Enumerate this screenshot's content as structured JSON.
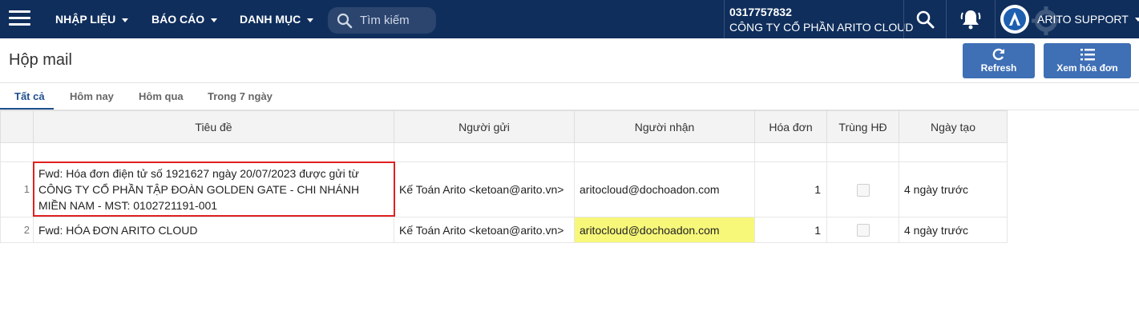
{
  "nav": {
    "items": [
      {
        "label": "NHẬP LIỆU"
      },
      {
        "label": "BÁO CÁO"
      },
      {
        "label": "DANH MỤC"
      }
    ],
    "search_placeholder": "Tìm kiếm",
    "company_tax_id": "0317757832",
    "company_name": "CÔNG TY CỔ PHẦN ARITO CLOUD",
    "user_name": "ARITO SUPPORT"
  },
  "page": {
    "title": "Hộp mail",
    "refresh_label": "Refresh",
    "view_invoice_label": "Xem hóa đơn"
  },
  "tabs": [
    {
      "label": "Tất cả",
      "active": true
    },
    {
      "label": "Hôm nay"
    },
    {
      "label": "Hôm qua"
    },
    {
      "label": "Trong 7 ngày"
    }
  ],
  "table": {
    "columns": [
      "Tiêu đề",
      "Người gửi",
      "Người nhận",
      "Hóa đơn",
      "Trùng HĐ",
      "Ngày tạo"
    ],
    "rows": [
      {
        "index": "1",
        "subject": "Fwd: Hóa đơn điện tử số 1921627 ngày 20/07/2023 được gửi từ CÔNG TY CỔ PHẦN TẬP ĐOÀN GOLDEN GATE - CHI NHÁNH MIỀN NAM - MST: 0102721191-001",
        "sender": "Kế Toán Arito <ketoan@arito.vn>",
        "recipient": "aritocloud@dochoadon.com",
        "invoices": "1",
        "duplicate": false,
        "created": "4 ngày trước"
      },
      {
        "index": "2",
        "subject": "Fwd: HÓA ĐƠN ARITO CLOUD",
        "sender": "Kế Toán Arito <ketoan@arito.vn>",
        "recipient": "aritocloud@dochoadon.com",
        "invoices": "1",
        "duplicate": false,
        "created": "4 ngày trước"
      }
    ]
  },
  "colors": {
    "navbar": "#0f2e5c",
    "button": "#3f6fb5",
    "highlight_cell": "#f7f77a",
    "annotation_box": "#e02020"
  }
}
